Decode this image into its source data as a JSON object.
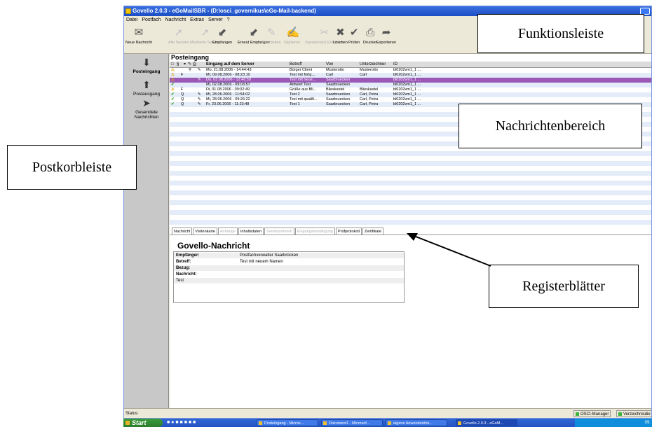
{
  "window": {
    "title": "Govello 2.0.3 - eGoMailSBR - (D:\\osci_governikus\\eGo-Mail-backend)"
  },
  "menu": [
    "Datei",
    "Postfach",
    "Nachricht",
    "Extras",
    "Server",
    "?"
  ],
  "toolbar": [
    {
      "label": "Neue Nachricht",
      "icon": "new-message-icon",
      "enabled": true
    },
    {
      "label": "Alle Senden",
      "icon": "send-all-icon",
      "enabled": false
    },
    {
      "label": "Markierte Senden",
      "icon": "send-selected-icon",
      "enabled": false
    },
    {
      "label": "Empfangen",
      "icon": "receive-icon",
      "enabled": true
    },
    {
      "label": "Erneut Empfangen",
      "icon": "receive-again-icon",
      "enabled": true
    },
    {
      "label": "Bearbeiten",
      "icon": "edit-icon",
      "enabled": false
    },
    {
      "label": "Signieren",
      "icon": "sign-icon",
      "enabled": false
    },
    {
      "label": "Signatur(en) Entfernen",
      "icon": "remove-signature-icon",
      "enabled": false
    },
    {
      "label": "Löschen",
      "icon": "delete-icon",
      "enabled": true
    },
    {
      "label": "Prüfen",
      "icon": "check-icon",
      "enabled": true
    },
    {
      "label": "Drucken",
      "icon": "print-icon",
      "enabled": true
    },
    {
      "label": "Exportieren",
      "icon": "export-icon",
      "enabled": true
    }
  ],
  "sidebar": [
    {
      "label": "Posteingang",
      "icon": "inbox-icon",
      "active": true
    },
    {
      "label": "Postausgang",
      "icon": "outbox-icon",
      "active": false
    },
    {
      "label": "Gesendete Nachrichten",
      "icon": "sent-messages-icon",
      "active": false
    }
  ],
  "folder_title": "Posteingang",
  "columns": {
    "received": "Eingang auf dem Server",
    "subject": "Betreff",
    "from": "Von",
    "signer": "Unterzeichner",
    "id": "ID"
  },
  "messages": [
    {
      "status": "warning",
      "flag": "",
      "attach": true,
      "sig": true,
      "received": "Mo, 21.08.2006 - 14:44:43",
      "subject": "Bürger Client",
      "from": "Musterotto",
      "signer": "Musterotto",
      "id": "bl0202vm1_1 ...",
      "selected": false
    },
    {
      "status": "warning",
      "flag": "F",
      "attach": false,
      "sig": false,
      "received": "Mi, 09.08.2006 - 08:23:10",
      "subject": "Test mit fortg...",
      "from": "Carl",
      "signer": "Carl",
      "id": "bl0202vm1_1 ...",
      "selected": false
    },
    {
      "status": "warning",
      "flag": "",
      "attach": false,
      "sig": true,
      "received": "Do, 03.08.2006 - 12:46:59",
      "subject": "Test mit neue...",
      "from": "Saarbruecken",
      "signer": "",
      "id": "bl0202vm1_1 ...",
      "selected": true
    },
    {
      "status": "ok",
      "flag": "",
      "attach": false,
      "sig": false,
      "received": "Mi, 02.08.2006 - 09:03:57",
      "subject": "Antwort Test",
      "from": "Saarbruecken",
      "signer": "",
      "id": "bl0202vm1_1 ...",
      "selected": false
    },
    {
      "status": "warning",
      "flag": "F",
      "attach": false,
      "sig": false,
      "received": "Di, 01.08.2006 - 09:02:49",
      "subject": "Grüße aus Bli...",
      "from": "Blieskastel",
      "signer": "Blieskastel",
      "id": "bl0202vm1_1 ...",
      "selected": false
    },
    {
      "status": "ok",
      "flag": "Q",
      "attach": false,
      "sig": true,
      "received": "Mi, 28.06.2006 - 11:54:02",
      "subject": "Test 2",
      "from": "Saarbruecken",
      "signer": "Carl, Petra",
      "id": "bl0202vm1_1 ...",
      "selected": false
    },
    {
      "status": "ok",
      "flag": "Q",
      "attach": false,
      "sig": true,
      "received": "Mi, 28.06.2006 - 09:26:22",
      "subject": "Test mit qualifi...",
      "from": "Saarbruecken",
      "signer": "Carl, Petra",
      "id": "bl0202vm1_1 ...",
      "selected": false
    },
    {
      "status": "ok",
      "flag": "Q",
      "attach": false,
      "sig": true,
      "received": "Fr, 23.06.2006 - 11:23:48",
      "subject": "Test 1",
      "from": "Saarbruecken",
      "signer": "Carl, Petra",
      "id": "bl0202vm1_1 ...",
      "selected": false
    }
  ],
  "tabs": [
    {
      "label": "Nachricht",
      "enabled": true,
      "active": true
    },
    {
      "label": "Visitenkarte",
      "enabled": true,
      "active": false
    },
    {
      "label": "Anhänge",
      "enabled": false,
      "active": false
    },
    {
      "label": "Inhaltsdaten",
      "enabled": true,
      "active": false
    },
    {
      "label": "Sendeprotokoll",
      "enabled": false,
      "active": false
    },
    {
      "label": "Eingangsbestätigung",
      "enabled": false,
      "active": false
    },
    {
      "label": "Prüfprotokoll",
      "enabled": true,
      "active": false
    },
    {
      "label": "Zertifikate",
      "enabled": true,
      "active": false
    }
  ],
  "detail": {
    "title": "Govello-Nachricht",
    "rows": [
      {
        "key": "Empfänger:",
        "value": "Postfachverwalter Saarbrücken"
      },
      {
        "key": "Betreff:",
        "value": "Test mit neuem Namen"
      },
      {
        "key": "Bezug:",
        "value": ""
      },
      {
        "key": "Nachricht:",
        "value": ""
      },
      {
        "key": "Test",
        "value": ""
      }
    ]
  },
  "status": {
    "label": "Status:",
    "items": [
      "OSCI-Manager",
      "Verzeichnisdie"
    ]
  },
  "taskbar": {
    "start": "Start",
    "tasks": [
      "Posteingang - Micros...",
      "Dokument1 - Microsof...",
      "eigene Anwenderdok...",
      "Govello 2.0.3 - eGoM..."
    ],
    "clock": "09:"
  },
  "callouts": {
    "funktionsleiste": "Funktionsleiste",
    "nachrichtenbereich": "Nachrichtenbereich",
    "postkorbleiste": "Postkorbleiste",
    "registerblaetter": "Registerblätter"
  },
  "colors": {
    "selection": "#9b59b6",
    "title_bar": "#1b4dc4",
    "sidebar": "#c8c8c8",
    "row_stripe": "#e3ecf8",
    "warning": "#e0a100",
    "ok": "#2e9a1c"
  }
}
